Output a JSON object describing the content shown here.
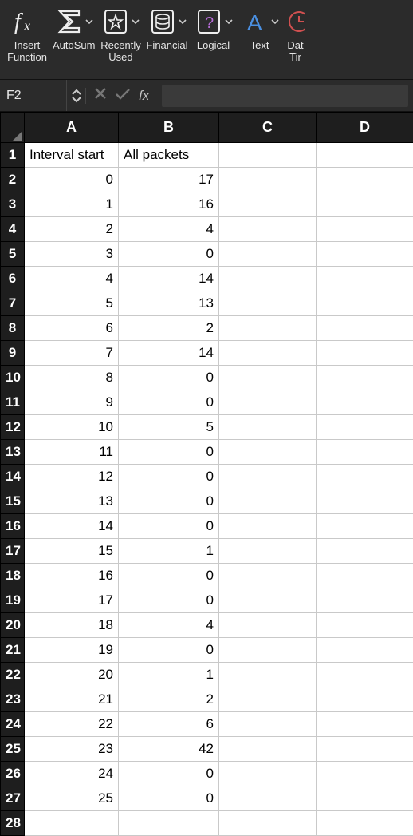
{
  "ribbon": {
    "items": [
      {
        "id": "insert-function",
        "label": "Insert\nFunction",
        "icon": "fx-icon",
        "dropdown": false
      },
      {
        "id": "autosum",
        "label": "AutoSum",
        "icon": "sigma-icon",
        "dropdown": true
      },
      {
        "id": "recently-used",
        "label": "Recently\nUsed",
        "icon": "star-box-icon",
        "dropdown": true
      },
      {
        "id": "financial",
        "label": "Financial",
        "icon": "ledger-icon",
        "dropdown": true
      },
      {
        "id": "logical",
        "label": "Logical",
        "icon": "question-box-icon",
        "dropdown": true
      },
      {
        "id": "text",
        "label": "Text",
        "icon": "letter-a-icon",
        "dropdown": true
      },
      {
        "id": "date-time",
        "label": "Dat\nTir",
        "icon": "clock-icon",
        "dropdown": true
      }
    ]
  },
  "formula_bar": {
    "name_box": "F2",
    "fx_label": "fx",
    "formula_value": ""
  },
  "sheet": {
    "columns": [
      "A",
      "B",
      "C",
      "D"
    ],
    "headers_row": {
      "A": "Interval start",
      "B": "All packets"
    },
    "active_cell": "F2",
    "rows": [
      {
        "n": 1,
        "A": "Interval start",
        "B": "All packets",
        "A_type": "txt",
        "B_type": "txt"
      },
      {
        "n": 2,
        "A": "0",
        "B": "17"
      },
      {
        "n": 3,
        "A": "1",
        "B": "16"
      },
      {
        "n": 4,
        "A": "2",
        "B": "4"
      },
      {
        "n": 5,
        "A": "3",
        "B": "0"
      },
      {
        "n": 6,
        "A": "4",
        "B": "14"
      },
      {
        "n": 7,
        "A": "5",
        "B": "13"
      },
      {
        "n": 8,
        "A": "6",
        "B": "2"
      },
      {
        "n": 9,
        "A": "7",
        "B": "14"
      },
      {
        "n": 10,
        "A": "8",
        "B": "0"
      },
      {
        "n": 11,
        "A": "9",
        "B": "0"
      },
      {
        "n": 12,
        "A": "10",
        "B": "5"
      },
      {
        "n": 13,
        "A": "11",
        "B": "0"
      },
      {
        "n": 14,
        "A": "12",
        "B": "0"
      },
      {
        "n": 15,
        "A": "13",
        "B": "0"
      },
      {
        "n": 16,
        "A": "14",
        "B": "0"
      },
      {
        "n": 17,
        "A": "15",
        "B": "1"
      },
      {
        "n": 18,
        "A": "16",
        "B": "0"
      },
      {
        "n": 19,
        "A": "17",
        "B": "0"
      },
      {
        "n": 20,
        "A": "18",
        "B": "4"
      },
      {
        "n": 21,
        "A": "19",
        "B": "0"
      },
      {
        "n": 22,
        "A": "20",
        "B": "1"
      },
      {
        "n": 23,
        "A": "21",
        "B": "2"
      },
      {
        "n": 24,
        "A": "22",
        "B": "6"
      },
      {
        "n": 25,
        "A": "23",
        "B": "42"
      },
      {
        "n": 26,
        "A": "24",
        "B": "0"
      },
      {
        "n": 27,
        "A": "25",
        "B": "0"
      },
      {
        "n": 28,
        "A": "",
        "B": ""
      }
    ]
  }
}
